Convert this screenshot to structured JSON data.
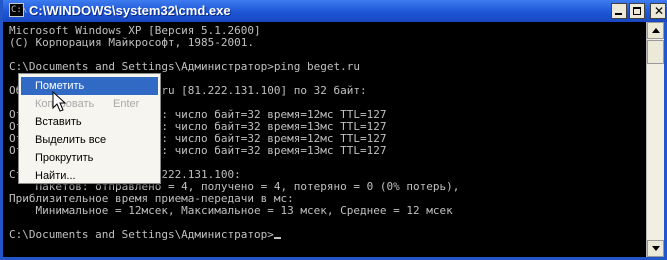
{
  "window": {
    "title": "C:\\WINDOWS\\system32\\cmd.exe",
    "icon": "cmd-icon"
  },
  "console": {
    "lines": [
      "Microsoft Windows XP [Версия 5.1.2600]",
      "(С) Корпорация Майкрософт, 1985-2001.",
      "",
      "C:\\Documents and Settings\\Администратор>ping beget.ru",
      "",
      "Обмен пакетами с beget.ru [81.222.131.100] по 32 байт:",
      "",
      "Ответ от 81.222.131.100: число байт=32 время=12мс TTL=127",
      "Ответ от 81.222.131.100: число байт=32 время=13мс TTL=127",
      "Ответ от 81.222.131.100: число байт=32 время=12мс TTL=127",
      "Ответ от 81.222.131.100: число байт=32 время=13мс TTL=127",
      "",
      "Статистика Ping для 81.222.131.100:",
      "    Пакетов: отправлено = 4, получено = 4, потеряно = 0 (0% потерь),",
      "Приблизительное время приема-передачи в мс:",
      "    Минимальное = 12мсек, Максимальное = 13 мсек, Среднее = 12 мсек",
      "",
      "C:\\Documents and Settings\\Администратор>"
    ]
  },
  "context_menu": {
    "items": [
      {
        "label": "Пометить",
        "state": "highlighted"
      },
      {
        "label": "Копировать",
        "shortcut": "Enter",
        "state": "disabled"
      },
      {
        "label": "Вставить",
        "state": "normal"
      },
      {
        "label": "Выделить все",
        "state": "normal"
      },
      {
        "label": "Прокрутить",
        "state": "normal"
      },
      {
        "label": "Найти...",
        "state": "normal"
      }
    ]
  },
  "colors": {
    "titlebar": "#1e56d6",
    "console_bg": "#000000",
    "console_text": "#c0c0c0",
    "menu_highlight": "#316ac5"
  }
}
